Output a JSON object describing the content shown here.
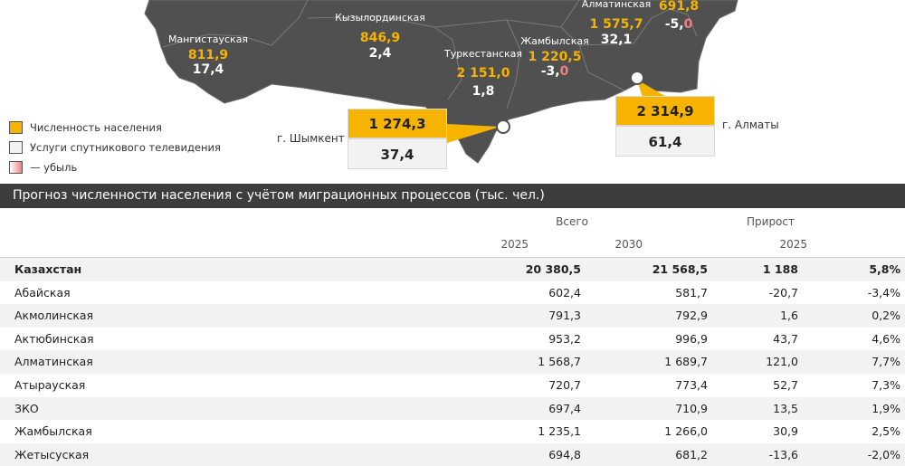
{
  "chart_data": [
    {
      "type": "map",
      "regions": [
        {
          "name": "Мангистауская",
          "population": "811,9",
          "satellite_tv": "17,4",
          "decline": false
        },
        {
          "name": "Кызылординская",
          "population": "846,9",
          "satellite_tv": "2,4",
          "decline": false
        },
        {
          "name": "Туркестанская",
          "population": "2 151,0",
          "satellite_tv": "1,8",
          "decline": false
        },
        {
          "name": "Жамбылская",
          "population": "1 220,5",
          "satellite_tv": "-3,0",
          "decline": true
        },
        {
          "name": "Алматинская",
          "population": "1 575,7",
          "satellite_tv": "32,1",
          "decline": false
        },
        {
          "name": "",
          "population": "691,8",
          "satellite_tv": "-5,0",
          "decline": true
        }
      ],
      "cities": [
        {
          "name": "г. Шымкент",
          "population": "1 274,3",
          "satellite_tv": "37,4"
        },
        {
          "name": "г. Алматы",
          "population": "2 314,9",
          "satellite_tv": "61,4"
        }
      ],
      "legend": [
        {
          "label": "Численность населения",
          "color": "#f6b400"
        },
        {
          "label": "Услуги спутникового телевидения",
          "color": "#f2f2f2"
        },
        {
          "label": "— убыль",
          "color": "#f08080"
        }
      ]
    },
    {
      "type": "table",
      "title": "Прогноз численности населения с учётом миграционных процессов (тыс. чел.)",
      "header_groups": [
        "Всего",
        "Прирост"
      ],
      "header_years": [
        "2025",
        "2030",
        "2025"
      ],
      "rows": [
        {
          "name": "Казахстан",
          "v2025": "20 380,5",
          "v2030": "21 568,5",
          "growth": "1 188",
          "growth_pct": "5,8%"
        },
        {
          "name": "Абайская",
          "v2025": "602,4",
          "v2030": "581,7",
          "growth": "-20,7",
          "growth_pct": "-3,4%"
        },
        {
          "name": "Акмолинская",
          "v2025": "791,3",
          "v2030": "792,9",
          "growth": "1,6",
          "growth_pct": "0,2%"
        },
        {
          "name": "Актюбинская",
          "v2025": "953,2",
          "v2030": "996,9",
          "growth": "43,7",
          "growth_pct": "4,6%"
        },
        {
          "name": "Алматинская",
          "v2025": "1 568,7",
          "v2030": "1 689,7",
          "growth": "121,0",
          "growth_pct": "7,7%"
        },
        {
          "name": "Атырауская",
          "v2025": "720,7",
          "v2030": "773,4",
          "growth": "52,7",
          "growth_pct": "7,3%"
        },
        {
          "name": "ЗКО",
          "v2025": "697,4",
          "v2030": "710,9",
          "growth": "13,5",
          "growth_pct": "1,9%"
        },
        {
          "name": "Жамбылская",
          "v2025": "1 235,1",
          "v2030": "1 266,0",
          "growth": "30,9",
          "growth_pct": "2,5%"
        },
        {
          "name": "Жетысуская",
          "v2025": "694,8",
          "v2030": "681,2",
          "growth": "-13,6",
          "growth_pct": "-2,0%"
        }
      ]
    }
  ]
}
